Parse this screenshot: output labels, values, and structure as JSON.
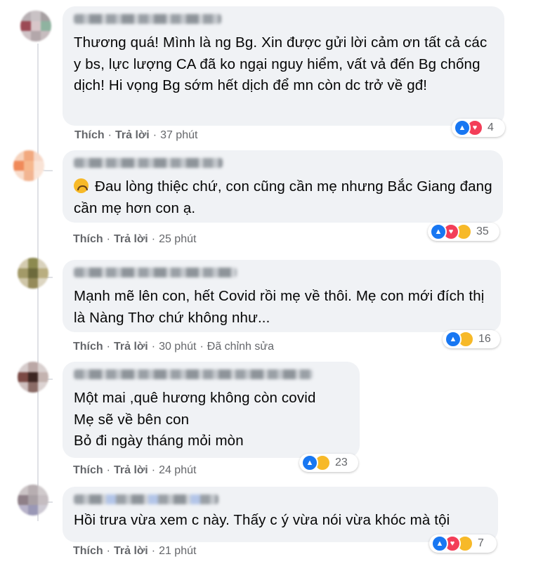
{
  "actions": {
    "like": "Thích",
    "reply": "Trả lời",
    "dot": "·"
  },
  "comments": [
    {
      "text": "Thương quá! Mình là ng Bg. Xin được gửi lời cảm ơn tất cả các y bs, lực lượng CA đã ko ngại nguy hiểm, vất vả đến Bg chống dịch! Hi vọng Bg sớm hết dịch để mn còn dc trở về gđ!",
      "time": "37 phút",
      "edited": "",
      "reaction_icons": [
        "like-icon",
        "love-icon"
      ],
      "reaction_count": "4"
    },
    {
      "text": "Đau lòng thiệc chứ, con cũng cần mẹ nhưng Bắc Giang đang cần mẹ hơn con ạ.",
      "time": "25 phút",
      "edited": "",
      "reaction_icons": [
        "like-icon",
        "love-icon",
        "sad-icon"
      ],
      "reaction_count": "35"
    },
    {
      "text": "Mạnh mẽ lên con, hết Covid rồi mẹ về thôi. Mẹ con mới đích thị là Nàng Thơ chứ không như...",
      "time": "30 phút",
      "edited": "Đã chỉnh sửa",
      "reaction_icons": [
        "like-icon",
        "haha-icon"
      ],
      "reaction_count": "16"
    },
    {
      "text": "Một mai ,quê hương không còn covid\nMẹ sẽ về bên con\nBỏ đi ngày tháng mỏi mòn",
      "time": "24 phút",
      "edited": "",
      "reaction_icons": [
        "like-icon",
        "care-icon"
      ],
      "reaction_count": "23"
    },
    {
      "text": "Hồi trưa vừa xem c này. Thấy c ý vừa nói vừa khóc mà tội",
      "time": "21 phút",
      "edited": "",
      "reaction_icons": [
        "like-icon",
        "love-icon",
        "sad-icon"
      ],
      "reaction_count": "7"
    }
  ],
  "colors": {
    "bubble": "#f0f2f5",
    "like": "#1877f2",
    "love": "#f33e58",
    "emoji": "#f7b928",
    "meta": "#65676b"
  }
}
